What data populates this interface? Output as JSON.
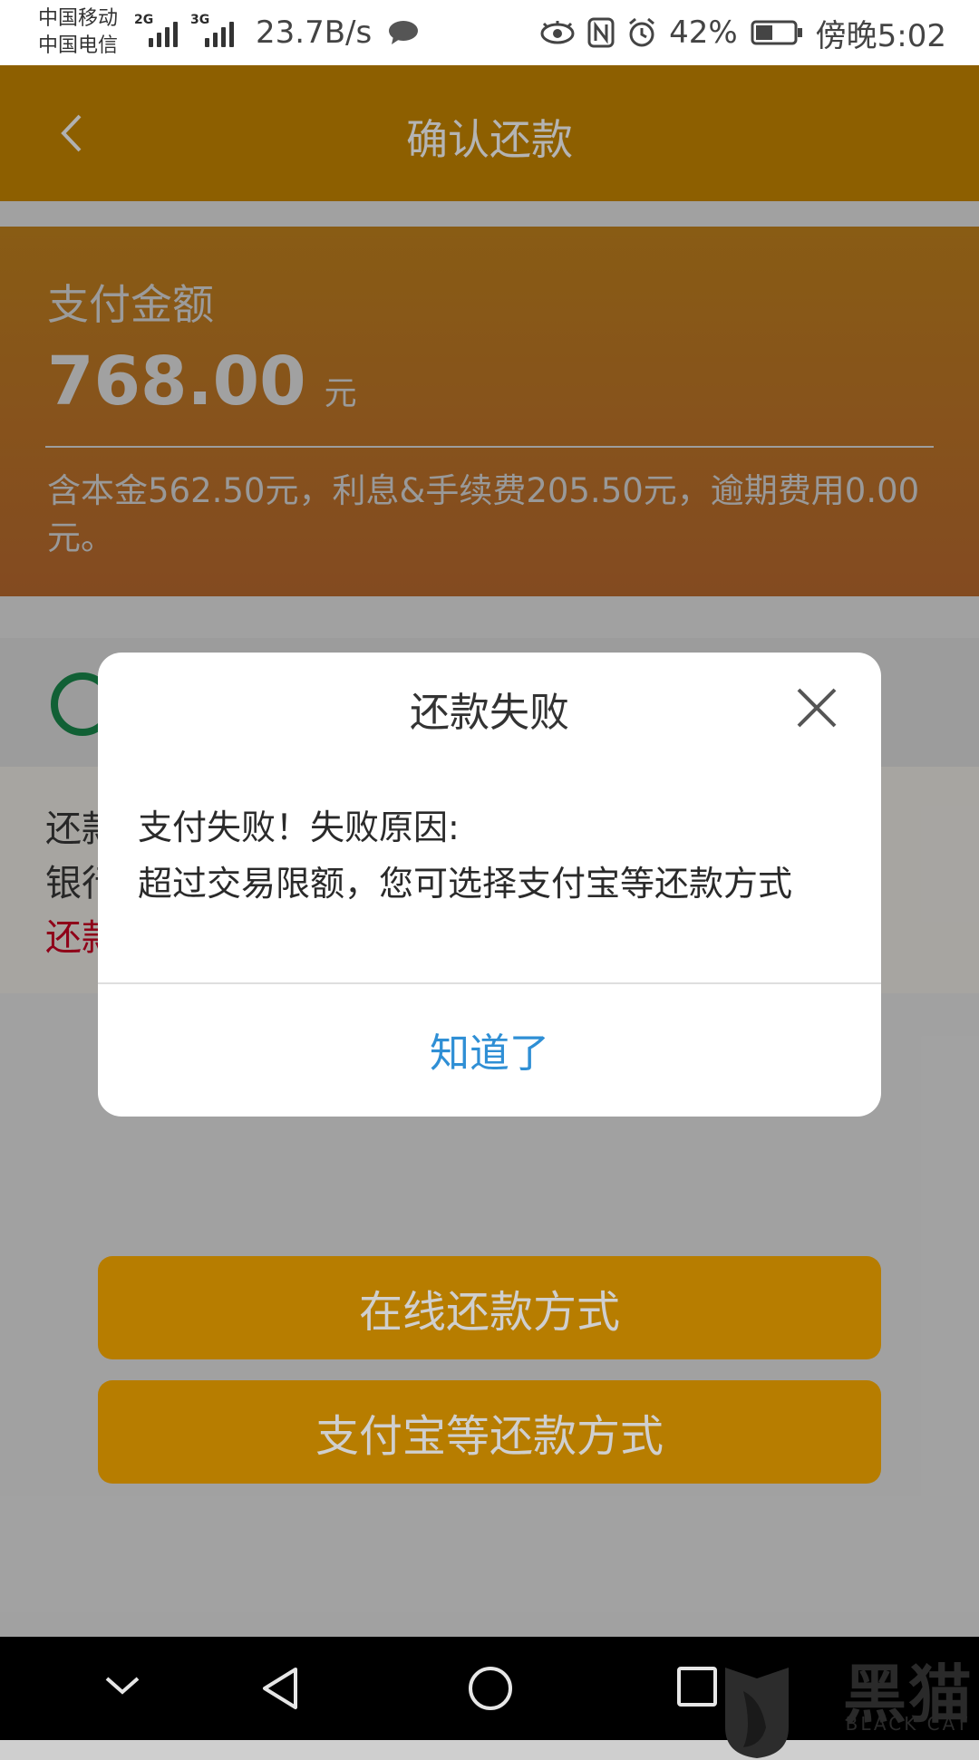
{
  "status_bar": {
    "carrier_1": "中国移动",
    "carrier_2": "中国电信",
    "signal_1_type": "2G",
    "signal_2_type": "3G",
    "net_speed": "23.7B/s",
    "battery": "42%",
    "time": "傍晚5:02",
    "icons": [
      "chat-icon",
      "eye-icon",
      "nfc-icon",
      "alarm-icon",
      "battery-icon"
    ]
  },
  "header": {
    "title": "确认还款",
    "back_icon": "chevron-left-icon"
  },
  "amount_card": {
    "label": "支付金额",
    "value": "768.00",
    "unit": "元",
    "breakdown": "含本金562.50元，利息&手续费205.50元，逾期费用0.00元。"
  },
  "notice": {
    "line_1": "还款",
    "line_2": "银行",
    "line_3": "还款"
  },
  "buttons": {
    "online": "在线还款方式",
    "alipay": "支付宝等还款方式"
  },
  "dialog": {
    "title": "还款失败",
    "message_1": "支付失败！失败原因:",
    "message_2": "超过交易限额，您可选择支付宝等还款方式",
    "confirm": "知道了"
  },
  "watermark": {
    "text": "黑猫",
    "sub": "BLACK CAT"
  },
  "colors": {
    "header": "#b57a00",
    "dialog_confirm": "#2f8fd5",
    "notice_red": "#b8001f",
    "bank_green": "#177c44"
  }
}
